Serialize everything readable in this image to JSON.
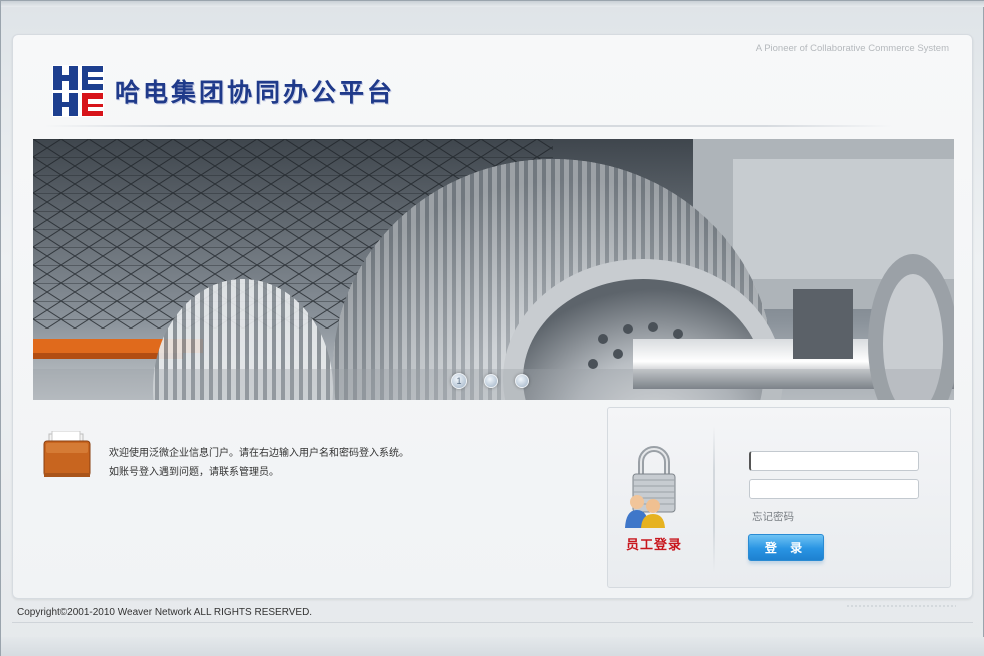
{
  "header": {
    "tagline": "A Pioneer of Collaborative Commerce System",
    "title": "哈电集团协同办公平台",
    "logo_icon": "harbin-electric-logo",
    "logo_colors": {
      "blue": "#1d3f8f",
      "red": "#d7141a"
    }
  },
  "banner": {
    "image_icon": "steam-turbine-rotor-photo",
    "slide_dots": [
      "1",
      "",
      ""
    ]
  },
  "welcome": {
    "icon": "briefcase-icon",
    "line1": "欢迎使用泛微企业信息门户。请在右边输入用户名和密码登入系统。",
    "line2": "如账号登入遇到问题，请联系管理员。"
  },
  "login": {
    "icon": "lock-users-icon",
    "label": "员工登录",
    "username": {
      "value": "",
      "placeholder": ""
    },
    "password": {
      "value": "",
      "placeholder": ""
    },
    "forgot_password": "忘记密码",
    "submit_label": "登 录",
    "accent_color": "#2994e3"
  },
  "footer": {
    "copyright": "Copyright©2001-2010 Weaver Network ALL RIGHTS RESERVED."
  }
}
